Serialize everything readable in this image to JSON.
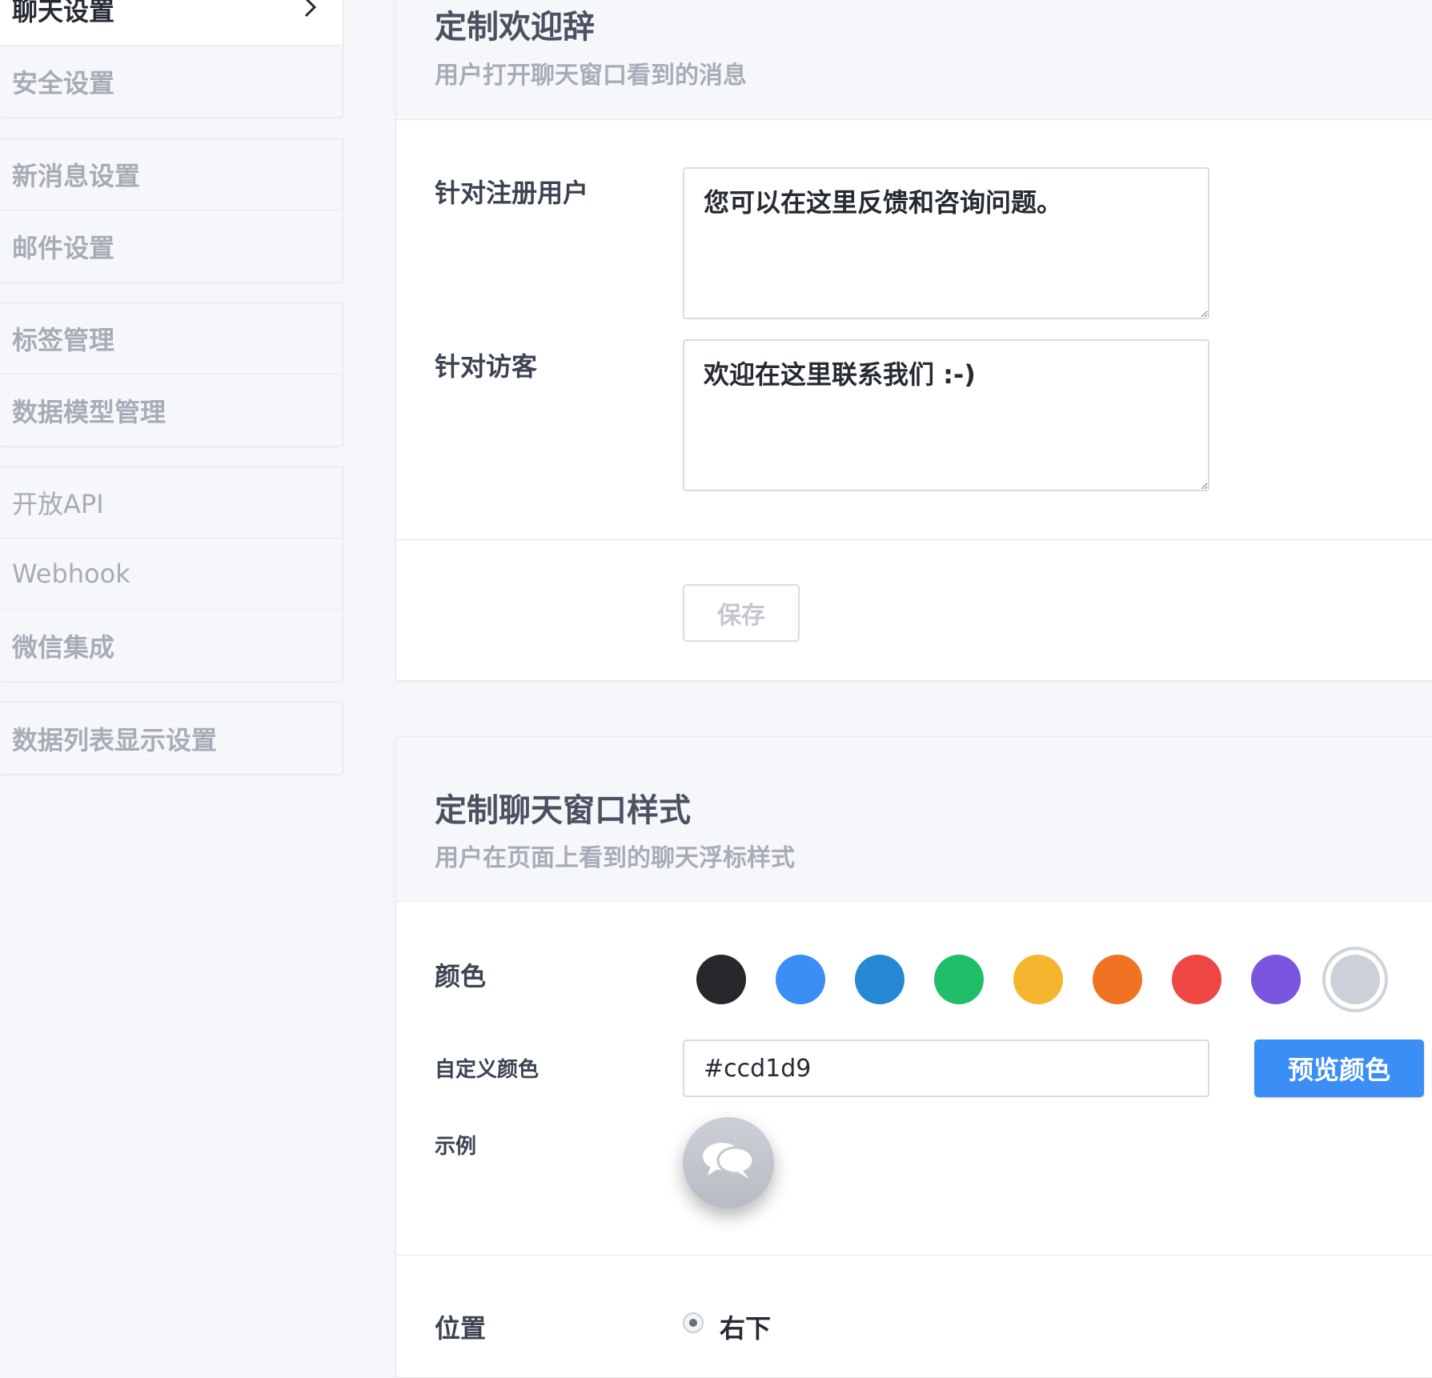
{
  "sidebar": {
    "groups": [
      [
        {
          "label": "聊天设置",
          "active": true
        },
        {
          "label": "安全设置"
        }
      ],
      [
        {
          "label": "新消息设置"
        },
        {
          "label": "邮件设置"
        }
      ],
      [
        {
          "label": "标签管理"
        },
        {
          "label": "数据模型管理"
        }
      ],
      [
        {
          "label": "开放API"
        },
        {
          "label": "Webhook"
        },
        {
          "label": "微信集成"
        }
      ],
      [
        {
          "label": "数据列表显示设置"
        }
      ]
    ]
  },
  "welcome": {
    "title": "定制欢迎辞",
    "subtitle": "用户打开聊天窗口看到的消息",
    "registered_label": "针对注册用户",
    "registered_value": "您可以在这里反馈和咨询问题。",
    "visitor_label": "针对访客",
    "visitor_value": "欢迎在这里联系我们 :-)",
    "save_label": "保存"
  },
  "style": {
    "title": "定制聊天窗口样式",
    "subtitle": "用户在页面上看到的聊天浮标样式",
    "color_label": "颜色",
    "swatches": [
      "#27282c",
      "#3a8ef6",
      "#2488d3",
      "#1fbf6a",
      "#f6b52f",
      "#f27223",
      "#ef4744",
      "#7a55e0",
      "#ccd1d9"
    ],
    "selected_swatch": "#ccd1d9",
    "custom_color_label": "自定义颜色",
    "custom_color_value": "#ccd1d9",
    "preview_label": "预览颜色",
    "example_label": "示例",
    "position_label": "位置",
    "position_option": "右下"
  }
}
